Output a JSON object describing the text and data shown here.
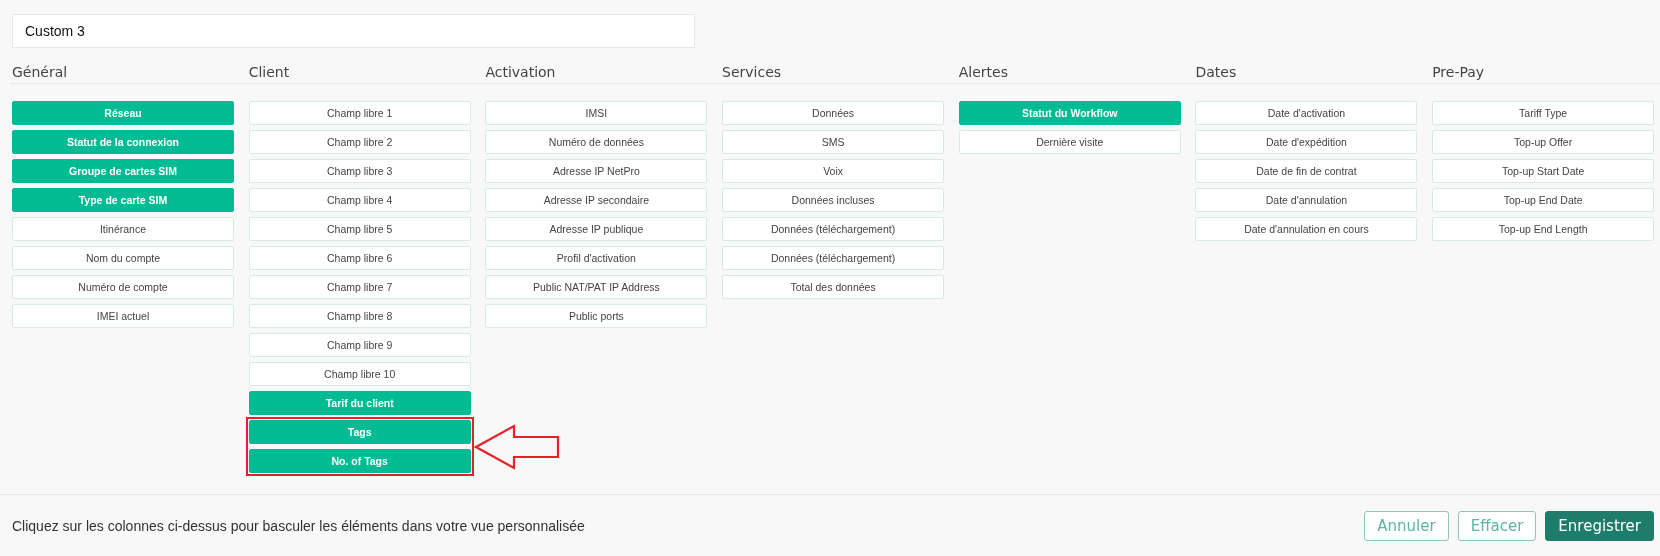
{
  "view_name": {
    "value": "Custom 3"
  },
  "columns": [
    {
      "heading": "Général",
      "items": [
        {
          "label": "Réseau",
          "selected": true
        },
        {
          "label": "Statut de la connexion",
          "selected": true
        },
        {
          "label": "Groupe de cartes SIM",
          "selected": true
        },
        {
          "label": "Type de carte SIM",
          "selected": true
        },
        {
          "label": "Itinérance",
          "selected": false
        },
        {
          "label": "Nom du compte",
          "selected": false
        },
        {
          "label": "Numéro de compte",
          "selected": false
        },
        {
          "label": "IMEI actuel",
          "selected": false
        }
      ]
    },
    {
      "heading": "Client",
      "items": [
        {
          "label": "Champ libre 1",
          "selected": false
        },
        {
          "label": "Champ libre 2",
          "selected": false
        },
        {
          "label": "Champ libre 3",
          "selected": false
        },
        {
          "label": "Champ libre 4",
          "selected": false
        },
        {
          "label": "Champ libre 5",
          "selected": false
        },
        {
          "label": "Champ libre 6",
          "selected": false
        },
        {
          "label": "Champ libre 7",
          "selected": false
        },
        {
          "label": "Champ libre 8",
          "selected": false
        },
        {
          "label": "Champ libre 9",
          "selected": false
        },
        {
          "label": "Champ libre 10",
          "selected": false
        },
        {
          "label": "Tarif du client",
          "selected": true
        }
      ],
      "highlighted_group": [
        {
          "label": "Tags",
          "selected": true
        },
        {
          "label": "No. of Tags",
          "selected": true
        }
      ]
    },
    {
      "heading": "Activation",
      "items": [
        {
          "label": "IMSI",
          "selected": false
        },
        {
          "label": "Numéro de données",
          "selected": false
        },
        {
          "label": "Adresse IP NetPro",
          "selected": false
        },
        {
          "label": "Adresse IP secondaire",
          "selected": false
        },
        {
          "label": "Adresse IP publique",
          "selected": false
        },
        {
          "label": "Profil d'activation",
          "selected": false
        },
        {
          "label": "Public NAT/PAT IP Address",
          "selected": false
        },
        {
          "label": "Public ports",
          "selected": false
        }
      ]
    },
    {
      "heading": "Services",
      "items": [
        {
          "label": "Données",
          "selected": false
        },
        {
          "label": "SMS",
          "selected": false
        },
        {
          "label": "Voix",
          "selected": false
        },
        {
          "label": "Données incluses",
          "selected": false
        },
        {
          "label": "Données (téléchargement)",
          "selected": false
        },
        {
          "label": "Données (téléchargement)",
          "selected": false
        },
        {
          "label": "Total des données",
          "selected": false
        }
      ]
    },
    {
      "heading": "Alertes",
      "items": [
        {
          "label": "Statut du Workflow",
          "selected": true
        },
        {
          "label": "Dernière visite",
          "selected": false
        }
      ]
    },
    {
      "heading": "Dates",
      "items": [
        {
          "label": "Date d'activation",
          "selected": false
        },
        {
          "label": "Date d'expédition",
          "selected": false
        },
        {
          "label": "Date de fin de contrat",
          "selected": false
        },
        {
          "label": "Date d'annulation",
          "selected": false
        },
        {
          "label": "Date d'annulation en cours",
          "selected": false
        }
      ]
    },
    {
      "heading": "Pre-Pay",
      "items": [
        {
          "label": "Tariff Type",
          "selected": false
        },
        {
          "label": "Top-up Offer",
          "selected": false
        },
        {
          "label": "Top-up Start Date",
          "selected": false
        },
        {
          "label": "Top-up End Date",
          "selected": false
        },
        {
          "label": "Top-up End Length",
          "selected": false
        }
      ]
    }
  ],
  "footer": {
    "hint": "Cliquez sur les colonnes ci-dessus pour basculer les éléments dans votre vue personnalisée",
    "buttons": [
      {
        "label": "Annuler",
        "kind": "outline"
      },
      {
        "label": "Effacer",
        "kind": "outline"
      },
      {
        "label": "Enregistrer",
        "kind": "primary"
      }
    ]
  }
}
